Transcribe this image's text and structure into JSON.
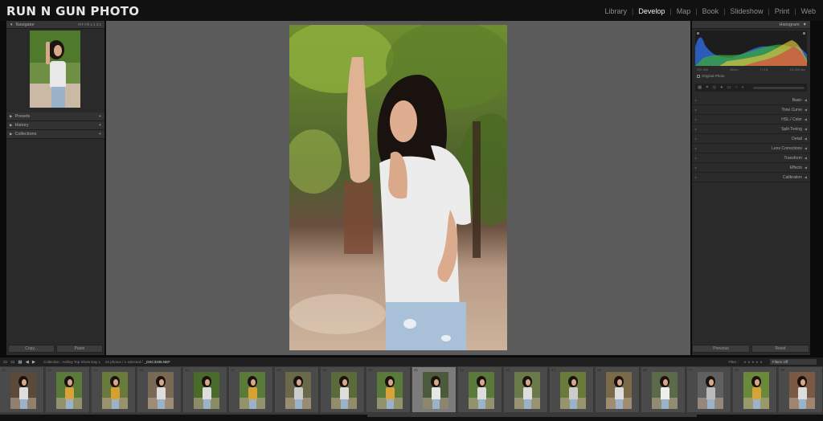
{
  "app": {
    "brand": "RUN N GUN PHOTO"
  },
  "modules": [
    {
      "label": "Library",
      "active": false
    },
    {
      "label": "Develop",
      "active": true
    },
    {
      "label": "Map",
      "active": false
    },
    {
      "label": "Book",
      "active": false
    },
    {
      "label": "Slideshow",
      "active": false
    },
    {
      "label": "Print",
      "active": false
    },
    {
      "label": "Web",
      "active": false
    }
  ],
  "left_panel": {
    "navigator": {
      "label": "Navigator",
      "zoom": "FIT  Fill  1:1  3:1"
    },
    "sections": [
      {
        "label": "Presets"
      },
      {
        "label": "History"
      },
      {
        "label": "Collections"
      }
    ],
    "copy_label": "Copy...",
    "paste_label": "Paste"
  },
  "right_panel": {
    "histogram_label": "Histogram",
    "stats": {
      "iso": "ISO 400",
      "lens": "35mm",
      "aperture": "f / 2.8",
      "shutter": "1/1,000 sec"
    },
    "original_label": "Original Photo",
    "sections": [
      {
        "label": "Basic"
      },
      {
        "label": "Tone Curve"
      },
      {
        "label": "HSL / Color"
      },
      {
        "label": "Split Toning"
      },
      {
        "label": "Detail"
      },
      {
        "label": "Lens Corrections"
      },
      {
        "label": "Transform"
      },
      {
        "label": "Effects"
      },
      {
        "label": "Calibration"
      }
    ],
    "previous_label": "Previous",
    "reset_label": "Reset"
  },
  "filmstrip_bar": {
    "collection": "Collection : Ashley Top Shots Day 1",
    "count": "22 photos / 1 selected /",
    "filename": "_DSC3335.NEF",
    "filter_label": "Filter :",
    "filter_value": "Filters Off"
  },
  "filmstrip": {
    "selected_index": 9,
    "thumbs": [
      {
        "num": "12",
        "tone": "#5b4a3a",
        "shirt": "#ddd"
      },
      {
        "num": "13",
        "tone": "#5a7a3a",
        "shirt": "#d8a23a"
      },
      {
        "num": "14",
        "tone": "#6a7a3a",
        "shirt": "#d4a030"
      },
      {
        "num": "15",
        "tone": "#7a6a55",
        "shirt": "#ddd"
      },
      {
        "num": "16",
        "tone": "#4a6a2a",
        "shirt": "#ddd"
      },
      {
        "num": "17",
        "tone": "#5a7a3a",
        "shirt": "#d6a332"
      },
      {
        "num": "18",
        "tone": "#6a6a4a",
        "shirt": "#ccc"
      },
      {
        "num": "19",
        "tone": "#5a6a3a",
        "shirt": "#ddd"
      },
      {
        "num": "20",
        "tone": "#5a7a3a",
        "shirt": "#d8a33a"
      },
      {
        "num": "21",
        "tone": "#4a5a3a",
        "shirt": "#e6e6e6"
      },
      {
        "num": "22",
        "tone": "#5a7a3a",
        "shirt": "#ddd"
      },
      {
        "num": "23",
        "tone": "#6a7a4a",
        "shirt": "#ddd"
      },
      {
        "num": "24",
        "tone": "#6a7a3a",
        "shirt": "#ccc"
      },
      {
        "num": "25",
        "tone": "#7a6a4a",
        "shirt": "#ddd"
      },
      {
        "num": "26",
        "tone": "#5a6a4a",
        "shirt": "#eee"
      },
      {
        "num": "27",
        "tone": "#606060",
        "shirt": "#bbb"
      },
      {
        "num": "28",
        "tone": "#6a8a3a",
        "shirt": "#d6a33a"
      },
      {
        "num": "29",
        "tone": "#7a5a45",
        "shirt": "#ddd"
      }
    ]
  }
}
